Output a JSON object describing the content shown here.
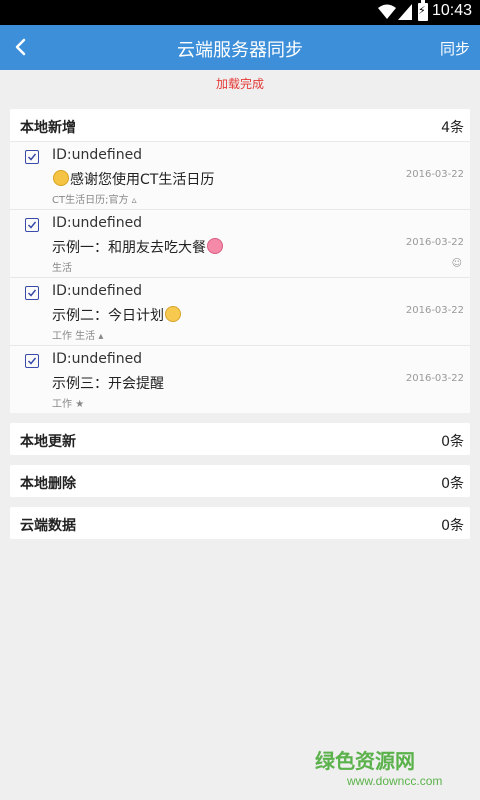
{
  "status_bar": {
    "time": "10:43"
  },
  "app_bar": {
    "title": "云端服务器同步",
    "action": "同步"
  },
  "load_state": "加载完成",
  "sections": {
    "local_new": {
      "label": "本地新增",
      "count": "4条",
      "items": [
        {
          "id": "ID:undefined",
          "text": "感谢您使用CT生活日历",
          "tag": "CT生活日历;官方",
          "date": "2016-03-22",
          "checked": true
        },
        {
          "id": "ID:undefined",
          "text": "示例一：和朋友去吃大餐",
          "tag": "生活",
          "date": "2016-03-22",
          "checked": true
        },
        {
          "id": "ID:undefined",
          "text": "示例二：今日计划",
          "tag": "工作 生活",
          "date": "2016-03-22",
          "checked": true
        },
        {
          "id": "ID:undefined",
          "text": "示例三：开会提醒",
          "tag": "工作",
          "date": "2016-03-22",
          "checked": true
        }
      ]
    },
    "local_update": {
      "label": "本地更新",
      "count": "0条"
    },
    "local_delete": {
      "label": "本地删除",
      "count": "0条"
    },
    "cloud_data": {
      "label": "云端数据",
      "count": "0条"
    }
  },
  "watermark": {
    "main": "绿色资源网",
    "url": "www.downcc.com"
  },
  "icons": [
    "wifi-icon",
    "signal-icon",
    "battery-icon",
    "back-arrow-icon",
    "checkbox-icon",
    "emoji-icon",
    "star-icon",
    "triangle-icon"
  ],
  "colors": {
    "appbar": "#3d8fd9",
    "load_text": "#e53935",
    "checkbox": "#3a4aa8",
    "watermark": "#5bb24b"
  }
}
